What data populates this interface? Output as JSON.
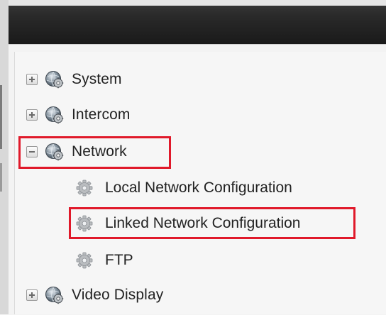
{
  "tree": {
    "items": [
      {
        "label": "System",
        "expander": "plus",
        "icon": "gear-globe-icon"
      },
      {
        "label": "Intercom",
        "expander": "plus",
        "icon": "gear-globe-icon"
      },
      {
        "label": "Network",
        "expander": "minus",
        "icon": "gear-globe-icon",
        "highlighted": true,
        "children": [
          {
            "label": "Local Network Configuration",
            "icon": "gear-icon"
          },
          {
            "label": "Linked Network Configuration",
            "icon": "gear-icon",
            "highlighted": true
          },
          {
            "label": "FTP",
            "icon": "gear-icon"
          }
        ]
      },
      {
        "label": "Video Display",
        "expander": "plus",
        "icon": "gear-globe-icon"
      }
    ]
  },
  "colors": {
    "highlight": "#e0192a",
    "titlebar": "#1f1f1f"
  }
}
